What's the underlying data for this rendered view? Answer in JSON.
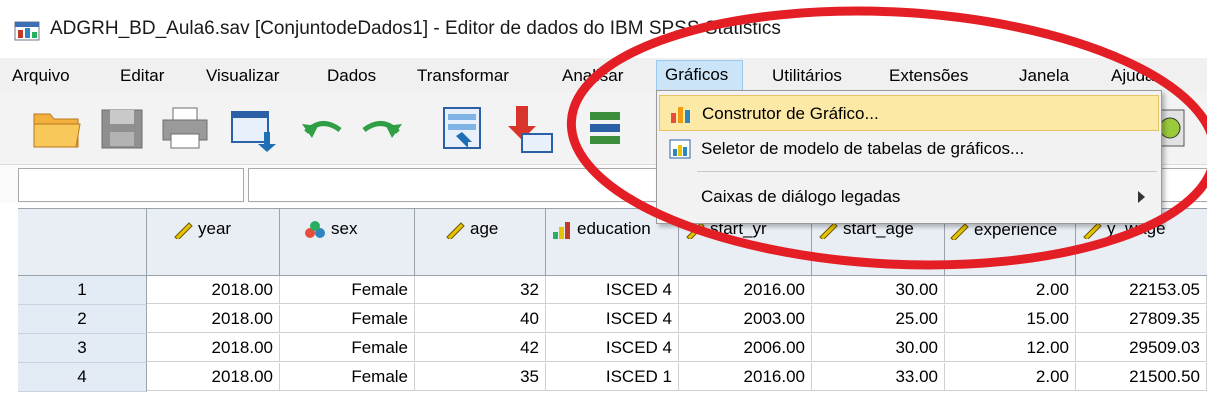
{
  "window": {
    "title": "ADGRH_BD_Aula6.sav [ConjuntodeDados1] - Editor de dados do IBM SPSS Statistics"
  },
  "menu": {
    "items": [
      "Arquivo",
      "Editar",
      "Visualizar",
      "Dados",
      "Transformar",
      "Analisar",
      "Gráficos",
      "Utilitários",
      "Extensões",
      "Janela",
      "Ajuda"
    ],
    "open": "Gráficos"
  },
  "dropdown": {
    "items": [
      {
        "label": "Construtor de Gráfico...",
        "icon": "chart-builder-icon",
        "highlighted": true
      },
      {
        "label": "Seletor de modelo de tabelas de gráficos...",
        "icon": "graphboard-icon",
        "highlighted": false
      },
      {
        "label": "Caixas de diálogo legadas",
        "icon": "",
        "submenu": true
      }
    ]
  },
  "toolbar": {
    "icons": [
      "open-folder-icon",
      "save-icon",
      "print-icon",
      "dialog-recall-icon",
      "undo-icon",
      "redo-icon",
      "goto-case-icon",
      "goto-variable-icon",
      "variables-icon"
    ]
  },
  "grid": {
    "columns": [
      {
        "name": "year",
        "icon": "scale-ruler-icon"
      },
      {
        "name": "sex",
        "icon": "nominal-icon"
      },
      {
        "name": "age",
        "icon": "scale-ruler-icon"
      },
      {
        "name": "education",
        "icon": "ordinal-icon"
      },
      {
        "name": "start_yr",
        "icon": "scale-ruler-icon"
      },
      {
        "name": "start_age",
        "icon": "scale-ruler-icon"
      },
      {
        "name": "experience",
        "icon": "scale-ruler-icon"
      },
      {
        "name": "y_wage",
        "icon": "scale-ruler-icon"
      }
    ],
    "rows": [
      {
        "n": "1",
        "cells": [
          "2018.00",
          "Female",
          "32",
          "ISCED 4",
          "2016.00",
          "30.00",
          "2.00",
          "22153.05"
        ]
      },
      {
        "n": "2",
        "cells": [
          "2018.00",
          "Female",
          "40",
          "ISCED 4",
          "2003.00",
          "25.00",
          "15.00",
          "27809.35"
        ]
      },
      {
        "n": "3",
        "cells": [
          "2018.00",
          "Female",
          "42",
          "ISCED 4",
          "2006.00",
          "30.00",
          "12.00",
          "29509.03"
        ]
      },
      {
        "n": "4",
        "cells": [
          "2018.00",
          "Female",
          "35",
          "ISCED 1",
          "2016.00",
          "33.00",
          "2.00",
          "21500.50"
        ]
      }
    ]
  },
  "colors": {
    "annotation_red": "#e31e24",
    "highlight": "#fde9a6",
    "menu_open": "#cce4f7"
  }
}
